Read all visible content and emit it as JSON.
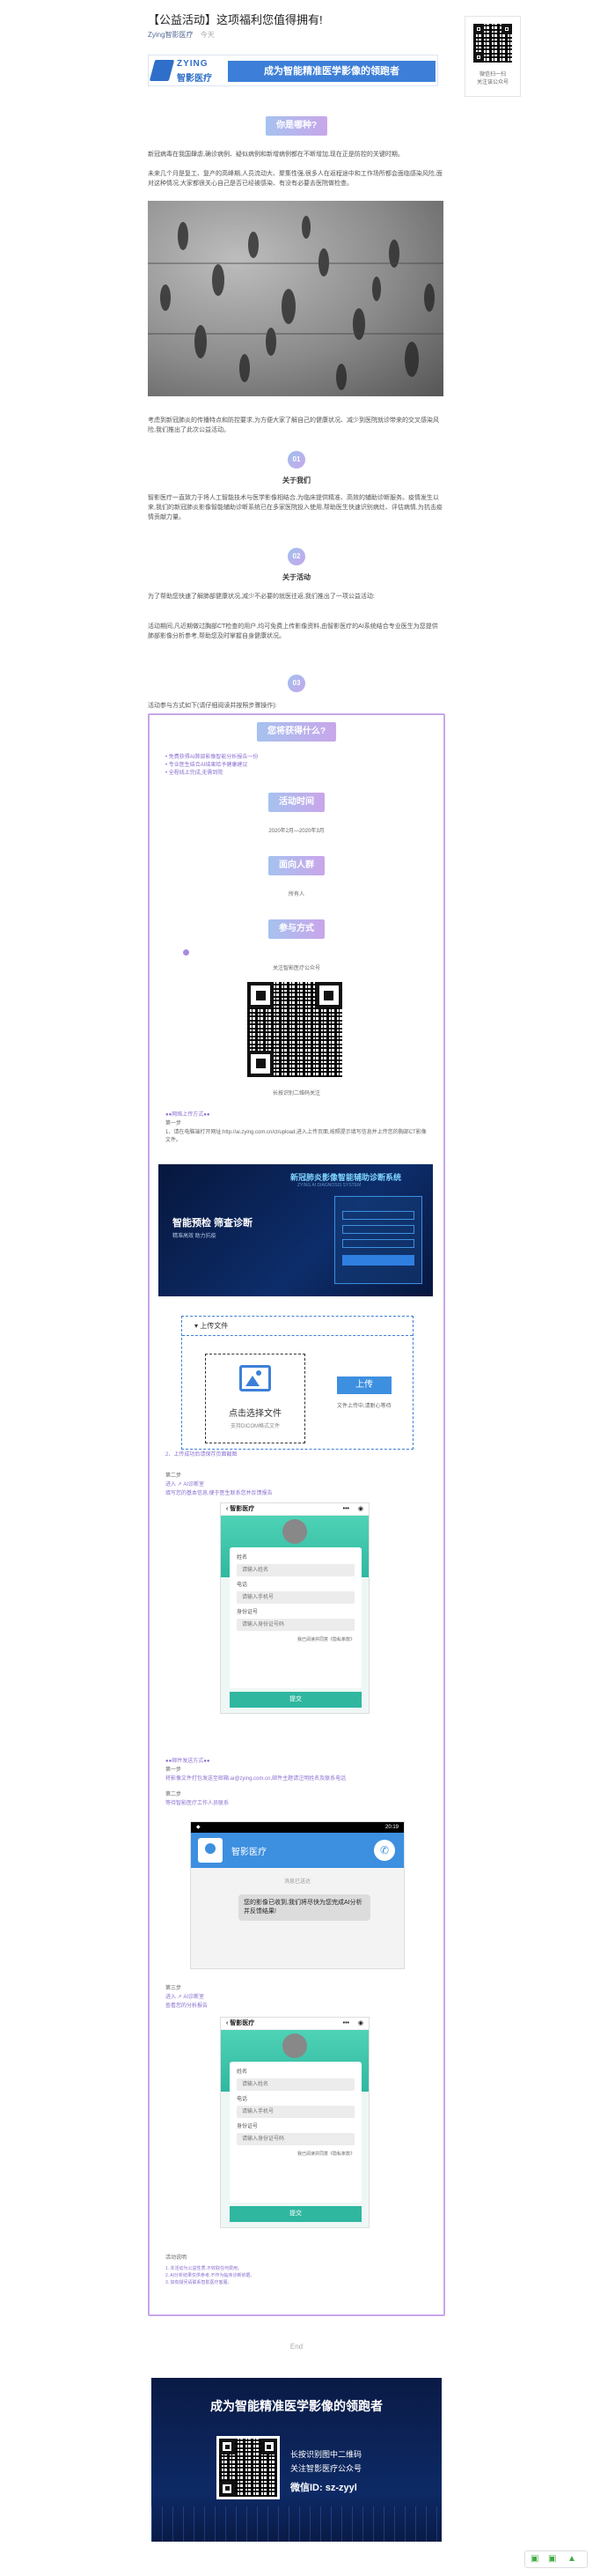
{
  "header": {
    "title": "【公益活动】这项福利您值得拥有!",
    "source": "Zying智影医疗",
    "date": "今天",
    "qr_caption_line1": "微信扫一扫",
    "qr_caption_line2": "关注该公众号"
  },
  "banner": {
    "logo_en": "ZYING",
    "logo_cn": "智影医疗",
    "slogan": "成为智能精准医学影像的领跑者"
  },
  "section1": {
    "heading": "你是哪种?",
    "p1": "新冠病毒在我国肆虐,确诊病例、疑似病例和新增病例都在不断增加,现在正是防控的关键时期。",
    "p2": "未来几个月是复工、复产的高峰期,人员流动大、聚集性强,很多人在返程途中和工作场所都会面临感染风险,面对这种情况,大家都很关心自己是否已经被感染、有没有必要去医院做检查。",
    "p3": "考虑到新冠肺炎的传播特点和防控要求,为方便大家了解自己的健康状况、减少到医院就诊带来的交叉感染风险,我们推出了此次公益活动。"
  },
  "section2": {
    "num": "01",
    "heading": "关于我们",
    "p1": "智影医疗一直致力于将人工智能技术与医学影像相结合,为临床提供精准、高效的辅助诊断服务。疫情发生以来,我们的新冠肺炎影像智能辅助诊断系统已在多家医院投入使用,帮助医生快速识别病灶、评估病情,为抗击疫情贡献力量。"
  },
  "section3": {
    "num": "02",
    "heading": "关于活动",
    "p1": "为了帮助您快速了解肺部健康状况,减少不必要的就医往返,我们推出了一项公益活动:",
    "p2": "活动期间,凡近期做过胸部CT检查的用户,均可免费上传影像资料,由智影医疗的AI系统结合专业医生为您提供肺部影像分析参考,帮助您及时掌握自身健康状况。"
  },
  "section4": {
    "num": "03",
    "intro": "活动参与方式如下(请仔细阅读并按照步骤操作):"
  },
  "box": {
    "what_heading": "您将获得什么?",
    "benefits": [
      "• 免费获得AI肺部影像智能分析报告一份",
      "• 专业医生结合AI结果给予健康建议",
      "• 全程线上完成,无需到院"
    ],
    "time_heading": "活动时间",
    "time_value": "2020年2月—2020年3月",
    "people_heading": "面向人群",
    "people_value": "所有人",
    "method_heading": "参与方式",
    "qr_caption_top": "关注智影医疗公众号",
    "qr_caption_bottom": "长按识别二维码关注",
    "step1_title": "●●网络上传方式●●",
    "step1_label": "第一步",
    "step1_text": "1、请在电脑端打开网址:http://ai.zying.com.cn/ct/upload,进入上传页面,按照提示填写信息并上传您的胸部CT影像文件。",
    "web_title": "新冠肺炎影像智能辅助诊断系统",
    "web_subtitle": "ZYING AI DIAGNOSIS SYSTEM",
    "web_left_title": "智能预检  筛查诊断",
    "web_left_sub": "精准高效 助力抗疫",
    "upload_header": "上传文件",
    "upload_click": "点击选择文件",
    "upload_hint": "支持DICOM格式文件",
    "upload_btn": "上传",
    "upload_note": "文件上传中,请耐心等待",
    "step1b": "2、上传成功后请保存页面截图",
    "step2_label": "第二步",
    "step2_text": "进入  ↗  AI诊断室",
    "step2_desc": "填写您的基本信息,便于医生联系您并反馈报告",
    "phone_title": "智影医疗",
    "phone_fields": [
      "姓名",
      "请输入姓名",
      "电话",
      "请输入手机号",
      "身份证号",
      "请输入身份证号码"
    ],
    "phone_agree": "我已阅读并同意《隐私条款》",
    "phone_submit": "提交",
    "step3_title": "●●邮件发送方式●●",
    "step3_label": "第一步",
    "step3_text": "将影像文件打包发送至邮箱:ai@zying.com.cn,邮件主题请注明姓名及联系电话",
    "step3b_label": "第二步",
    "step3b_text": "等待智影医疗工作人员联系",
    "chat_time": "20:19",
    "chat_name": "智影医疗",
    "chat_hint": "消息已送达",
    "chat_msg": "您的影像已收到,我们将尽快为您完成AI分析并反馈结果!",
    "step4_label": "第三步",
    "step4_text": "进入  ↗  AI诊断室",
    "step4_desc": "查看您的分析报告",
    "notes_title": "活动说明",
    "notes": [
      "1. 本活动为公益性质,不收取任何费用。",
      "2. AI分析结果仅供参考,不作为临床诊断依据。",
      "3. 如有疑问请联系智影医疗客服。"
    ]
  },
  "footer": {
    "end": "End",
    "slogan": "成为智能精准医学影像的领跑者",
    "line1": "长按识别图中二维码",
    "line2": "关注智影医疗公众号",
    "wechat": "微信ID: sz-zyyl"
  },
  "colors": {
    "accent_blue": "#3d7fd8",
    "accent_purple": "#c9a6ea",
    "dark_navy": "#0b1f4a"
  }
}
